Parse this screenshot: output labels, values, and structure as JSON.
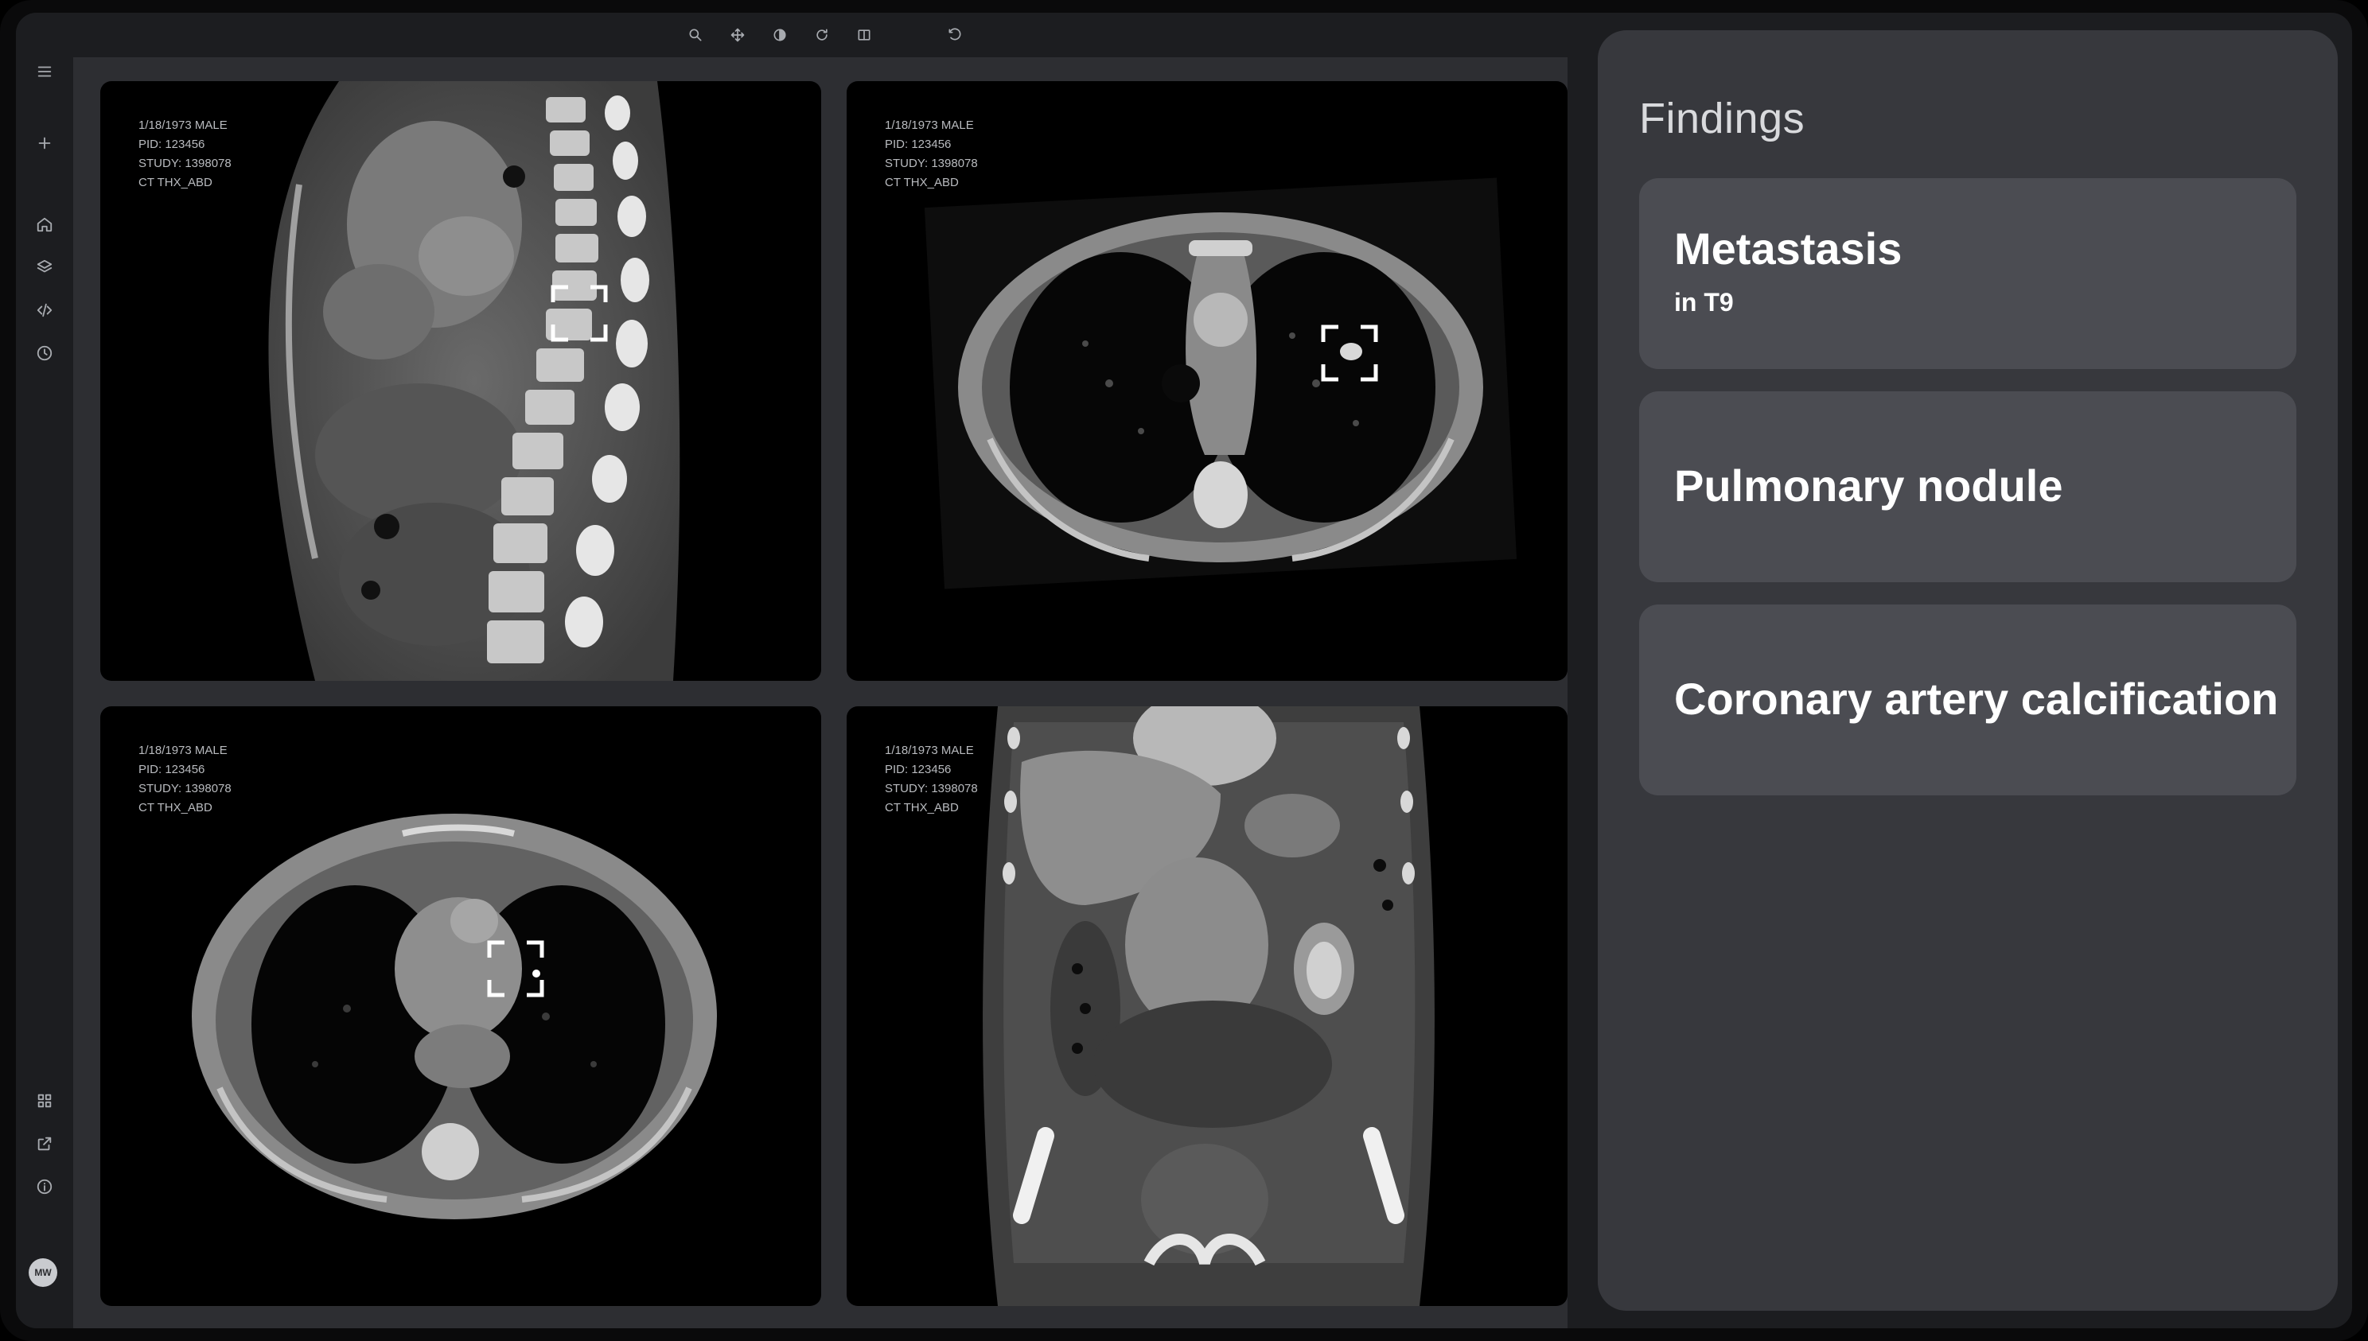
{
  "toolbar": {
    "tools": [
      "zoom-icon",
      "pan-icon",
      "contrast-icon",
      "rotate-icon",
      "split-view-icon",
      "undo-icon"
    ]
  },
  "rail": {
    "top": [
      "menu-icon",
      "add-icon",
      "home-icon",
      "layers-icon",
      "code-icon",
      "history-icon"
    ],
    "bottom": [
      "grid-icon",
      "external-link-icon",
      "info-icon"
    ],
    "avatar": "MW"
  },
  "viewports": [
    {
      "meta": {
        "dob_sex": "1/18/1973 MALE",
        "pid": "PID: 123456",
        "study": "STUDY: 1398078",
        "series": "CT THX_ABD"
      },
      "view": "sagittal"
    },
    {
      "meta": {
        "dob_sex": "1/18/1973 MALE",
        "pid": "PID: 123456",
        "study": "STUDY: 1398078",
        "series": "CT THX_ABD"
      },
      "view": "axial-lung"
    },
    {
      "meta": {
        "dob_sex": "1/18/1973 MALE",
        "pid": "PID: 123456",
        "study": "STUDY: 1398078",
        "series": "CT THX_ABD"
      },
      "view": "axial-heart"
    },
    {
      "meta": {
        "dob_sex": "1/18/1973 MALE",
        "pid": "PID: 123456",
        "study": "STUDY: 1398078",
        "series": "CT THX_ABD"
      },
      "view": "coronal"
    }
  ],
  "findings": {
    "title": "Findings",
    "items": [
      {
        "title": "Metastasis",
        "subtitle": "in T9"
      },
      {
        "title": "Pulmonary nodule",
        "subtitle": ""
      },
      {
        "title": "Coronary artery calcification",
        "subtitle": ""
      }
    ]
  },
  "colors": {
    "panel": "#37383d",
    "card": "#4b4c52",
    "viewer_bg": "#2d2e32"
  }
}
